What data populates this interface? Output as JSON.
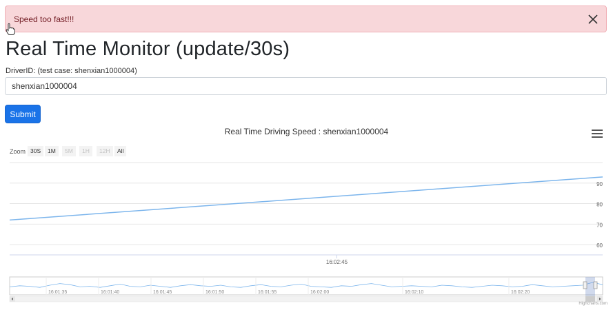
{
  "alert": {
    "message": "Speed too fast!!!",
    "close_glyph": "✕"
  },
  "page": {
    "title": "Real Time Monitor (update/30s)"
  },
  "form": {
    "driver_label": "DriverID: (test case: shenxian1000004)",
    "driver_value": "shenxian1000004",
    "submit_label": "Submit"
  },
  "chart_data": {
    "type": "line",
    "title": "Real Time Driving Speed : shenxian1000004",
    "zoom_label": "Zoom",
    "range_buttons": [
      {
        "label": "30S",
        "enabled": true
      },
      {
        "label": "1M",
        "enabled": true
      },
      {
        "label": "5M",
        "enabled": false
      },
      {
        "label": "1H",
        "enabled": false
      },
      {
        "label": "12H",
        "enabled": false
      },
      {
        "label": "All",
        "enabled": true
      }
    ],
    "y_ticks": [
      60,
      70,
      80,
      90
    ],
    "ylim": [
      55,
      100
    ],
    "x_tick_labels": [
      "16:02:45"
    ],
    "series": [
      {
        "color": "#7cb5ec",
        "x": [
          "16:02:29",
          "16:02:58"
        ],
        "y": [
          72,
          93
        ]
      }
    ],
    "navigator": {
      "tick_labels": [
        "16:01:35",
        "16:01:40",
        "16:01:45",
        "16:01:50",
        "16:01:55",
        "16:02:00",
        "16:02:10",
        "16:02:20"
      ],
      "series_y": [
        72,
        74,
        73,
        71,
        75,
        78,
        76,
        72,
        73,
        71,
        74,
        77,
        73,
        72,
        75,
        73,
        71,
        74,
        76,
        74,
        73,
        75,
        72,
        71,
        74,
        76,
        73,
        72,
        75,
        77,
        73,
        72,
        71,
        74,
        73,
        76,
        78,
        75,
        72,
        73,
        74,
        73,
        72,
        75,
        74,
        72,
        71,
        73,
        75,
        74,
        72,
        73,
        76,
        74,
        72,
        73,
        74,
        75,
        80,
        76
      ]
    },
    "credits": "Highcharts.com"
  }
}
